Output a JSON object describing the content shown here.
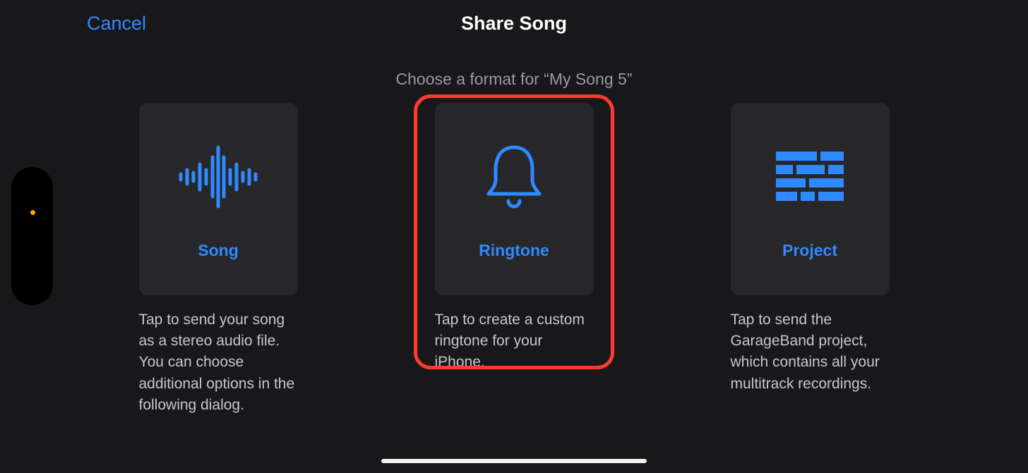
{
  "header": {
    "cancel": "Cancel",
    "title": "Share Song",
    "subtitle": "Choose a format for “My Song 5”"
  },
  "options": {
    "song": {
      "label": "Song",
      "desc": "Tap to send your song as a stereo audio file. You can choose additional options in the following dialog."
    },
    "ringtone": {
      "label": "Ringtone",
      "desc": "Tap to create a custom ringtone for your iPhone."
    },
    "project": {
      "label": "Project",
      "desc": "Tap to send the GarageBand project, which contains all your multitrack recordings."
    }
  },
  "colors": {
    "accent": "#2f89ff",
    "highlight": "#ff3a2f",
    "background": "#18181a",
    "card": "#272729"
  }
}
